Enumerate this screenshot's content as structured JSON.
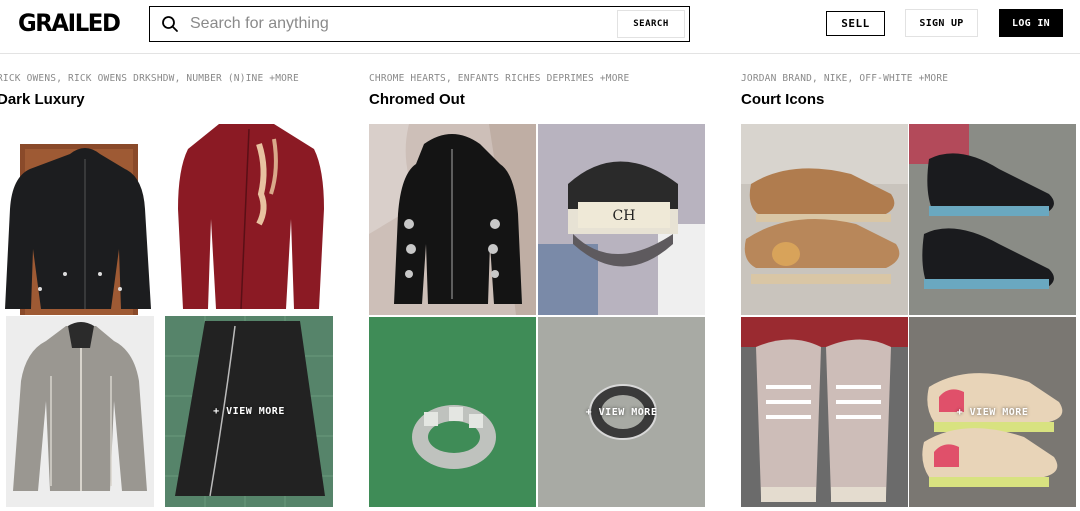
{
  "header": {
    "logo": "GRAILED",
    "search": {
      "placeholder": "Search for anything",
      "value": "",
      "button_label": "SEARCH",
      "icon": "search-icon"
    },
    "sell_label": "SELL",
    "signup_label": "SIGN UP",
    "login_label": "LOG IN"
  },
  "collections": [
    {
      "brands": "RICK OWENS, RICK OWENS DRKSHDW, NUMBER (N)INE +MORE",
      "title": "Dark Luxury",
      "items": [
        {
          "name": "black-hooded-jacket-image"
        },
        {
          "name": "red-denim-jacket-image"
        },
        {
          "name": "grey-zip-jacket-image"
        },
        {
          "name": "black-skirt-image",
          "overlay": "+ VIEW MORE"
        }
      ]
    },
    {
      "brands": "CHROME HEARTS, ENFANTS RICHES DEPRIMES +MORE",
      "title": "Chromed Out",
      "items": [
        {
          "name": "black-zip-hoodie-image"
        },
        {
          "name": "trucker-cap-image"
        },
        {
          "name": "silver-cross-ring-image"
        },
        {
          "name": "silver-band-ring-image",
          "overlay": "+ VIEW MORE"
        }
      ]
    },
    {
      "brands": "JORDAN BRAND, NIKE, OFF-WHITE +MORE",
      "title": "Court Icons",
      "items": [
        {
          "name": "air-max-95-sneakers-image"
        },
        {
          "name": "jordan-11-black-sneakers-image"
        },
        {
          "name": "jordan-4-grey-sneakers-image"
        },
        {
          "name": "jordan-4-pink-sneakers-image",
          "overlay": "+ VIEW MORE"
        }
      ]
    }
  ],
  "colors": {
    "accent": "#000000",
    "muted_text": "#8a8a8a",
    "border": "#e3e3e3"
  }
}
